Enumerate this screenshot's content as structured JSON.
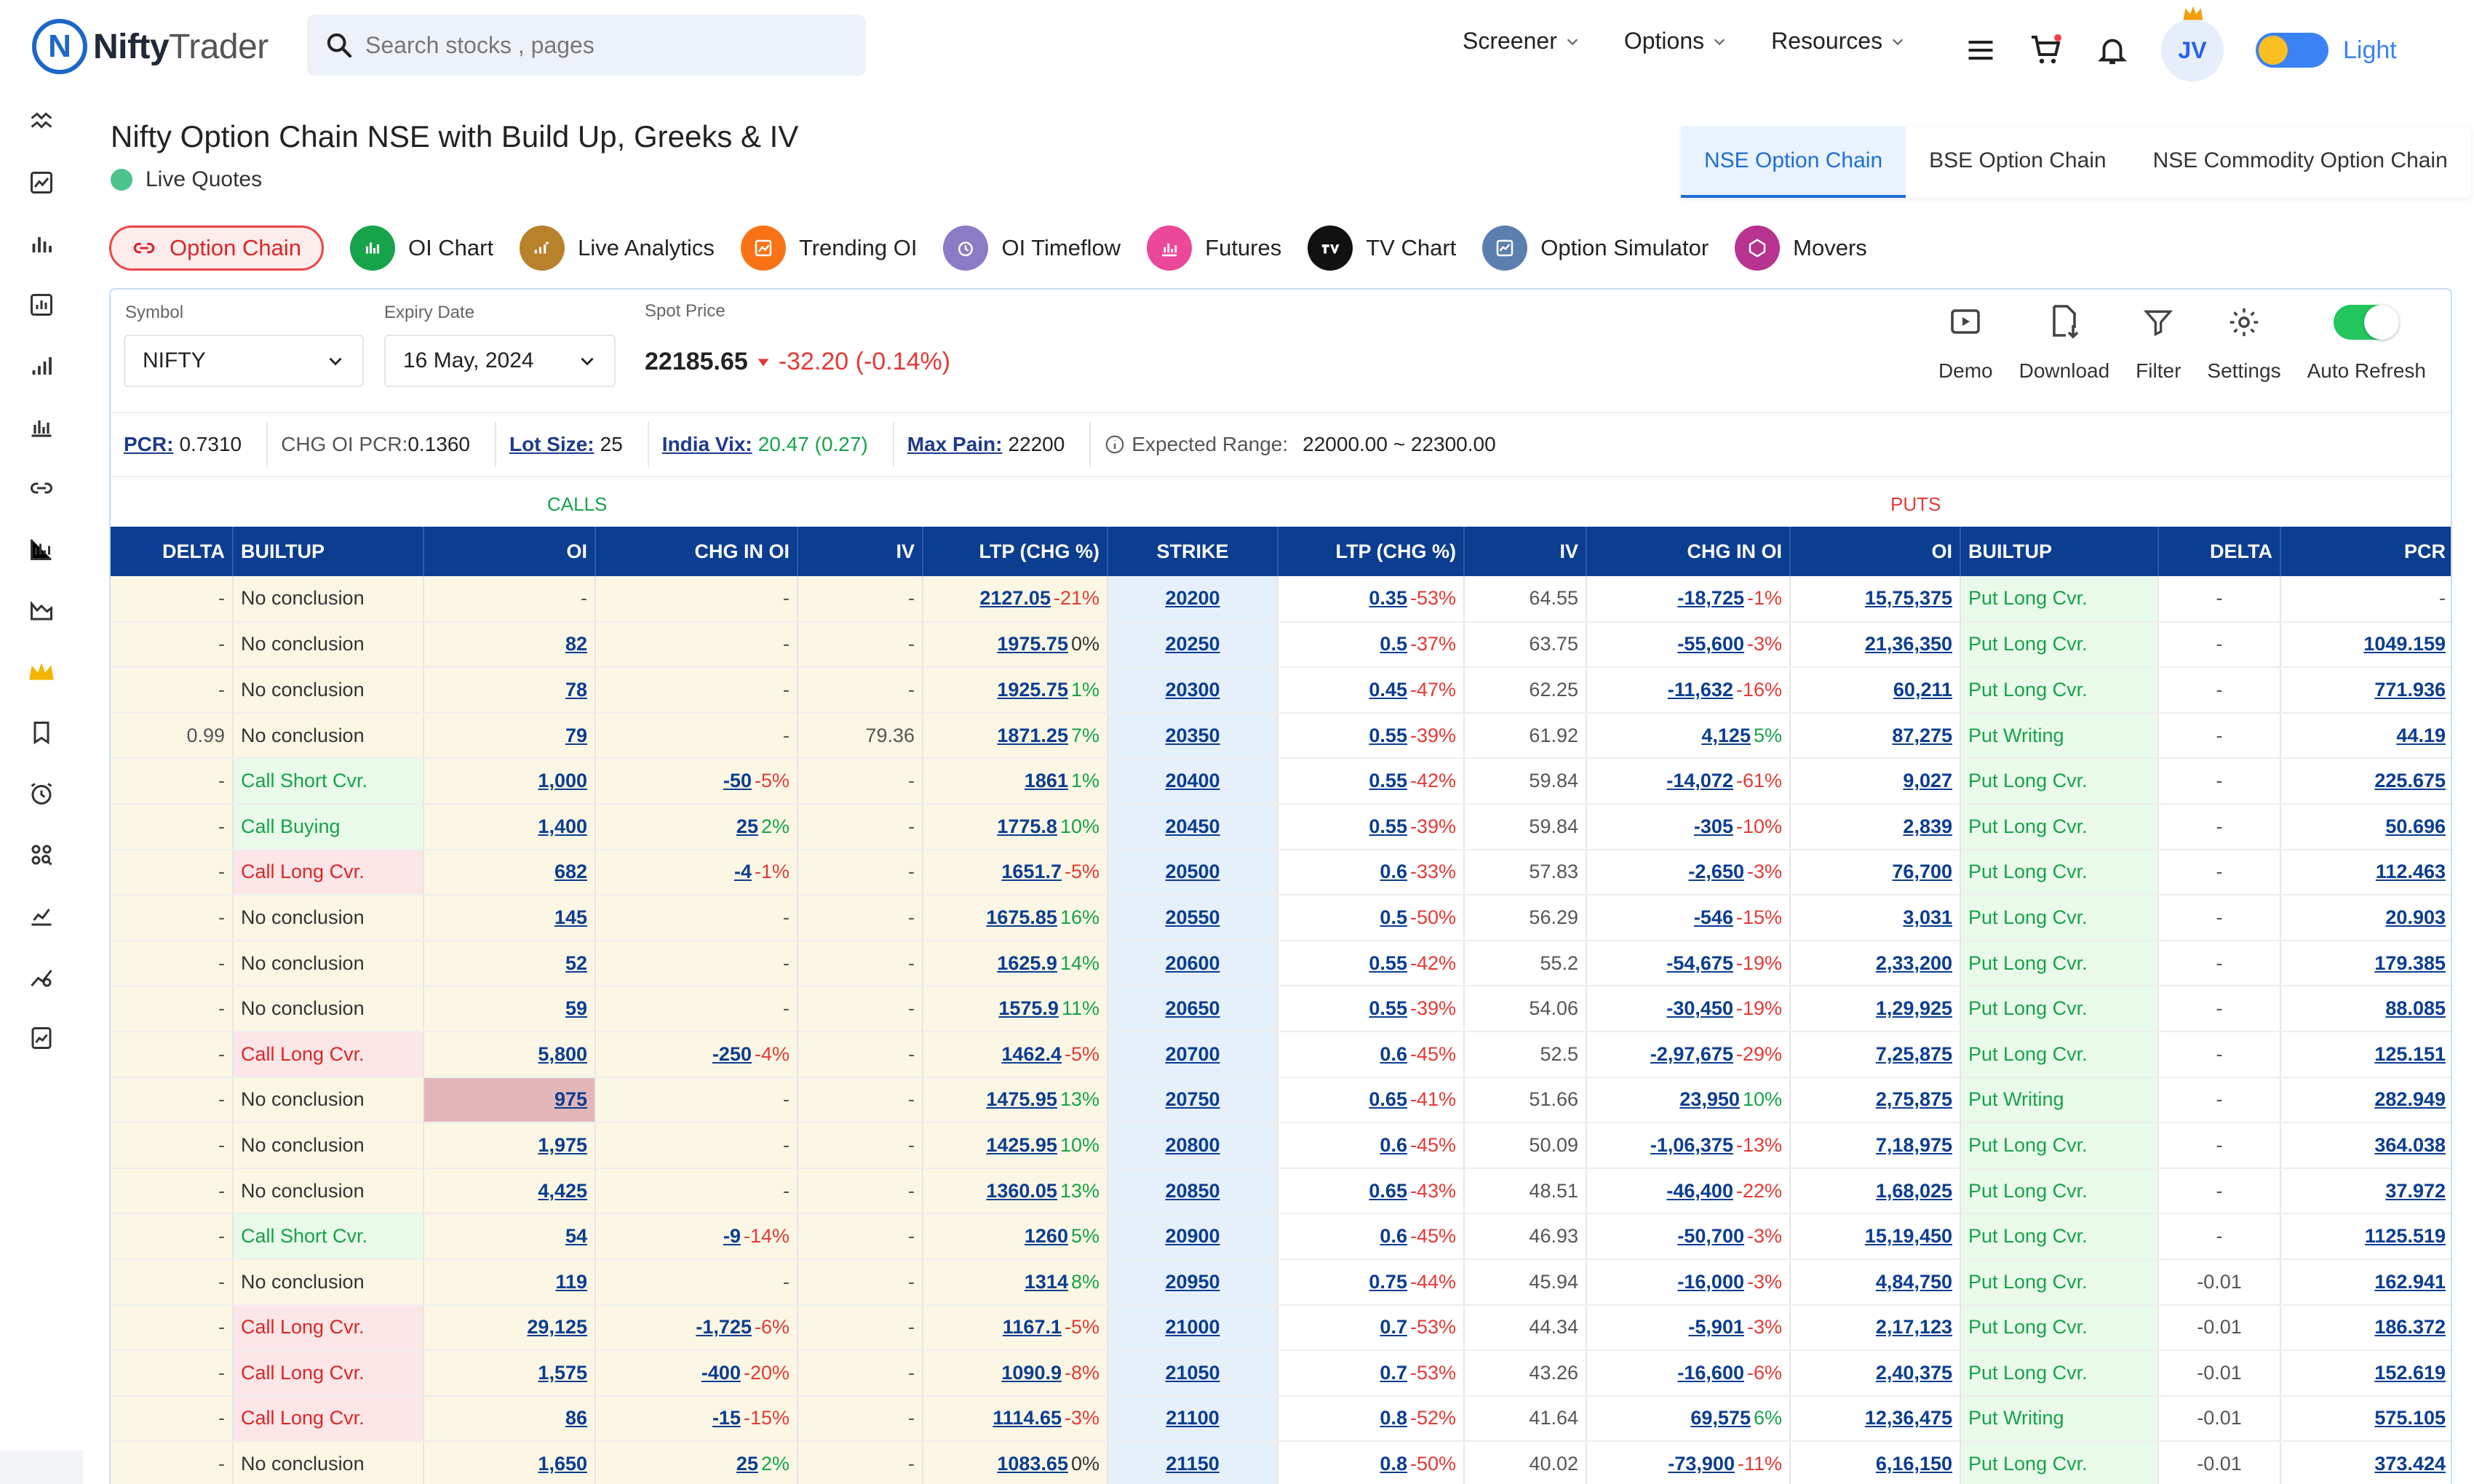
{
  "brand": {
    "name": "NiftyTrader",
    "name_a": "Nifty",
    "name_b": "Trader"
  },
  "search": {
    "placeholder": "Search stocks , pages"
  },
  "nav": {
    "screener": "Screener",
    "options": "Options",
    "resources": "Resources"
  },
  "user": {
    "initials": "JV"
  },
  "theme": {
    "label": "Light"
  },
  "page": {
    "title": "Nifty Option Chain NSE with Build Up, Greeks & IV",
    "live": "Live Quotes"
  },
  "chain_tabs": [
    "NSE Option Chain",
    "BSE Option Chain",
    "NSE Commodity Option Chain"
  ],
  "tools": [
    "Option Chain",
    "OI Chart",
    "Live Analytics",
    "Trending OI",
    "OI Timeflow",
    "Futures",
    "TV Chart",
    "Option Simulator",
    "Movers"
  ],
  "filters": {
    "symbol_label": "Symbol",
    "symbol": "NIFTY",
    "expiry_label": "Expiry Date",
    "expiry": "16 May, 2024",
    "spot_label": "Spot Price",
    "spot": "22185.65",
    "spot_change": "-32.20 (-0.14%)"
  },
  "actions": [
    "Demo",
    "Download",
    "Filter",
    "Settings",
    "Auto Refresh"
  ],
  "stats": {
    "pcr_k": "PCR:",
    "pcr": "0.7310",
    "chgoi_k": "CHG OI PCR:",
    "chgoi": "0.1360",
    "lot_k": "Lot Size:",
    "lot": "25",
    "vix_k": "India Vix:",
    "vix": "20.47 (0.27)",
    "maxpain_k": "Max Pain:",
    "maxpain": "22200",
    "range_k": "Expected Range:",
    "range": "22000.00 ~ 22300.00"
  },
  "sides": {
    "calls": "CALLS",
    "puts": "PUTS"
  },
  "headers": [
    "DELTA",
    "BUILTUP",
    "OI",
    "CHG IN OI",
    "IV",
    "LTP (CHG %)",
    "STRIKE",
    "LTP (CHG %)",
    "IV",
    "CHG IN OI",
    "OI",
    "BUILTUP",
    "DELTA",
    "PCR"
  ],
  "rows": [
    {
      "cd": "-",
      "cb": "No conclusion",
      "cbt": "none",
      "coi": "-",
      "cchg": "-",
      "cchgp": "",
      "civ": "-",
      "cltp": "2127.05",
      "cltpp": "-21%",
      "strike": "20200",
      "pltp": "0.35",
      "pltpp": "-53%",
      "piv": "64.55",
      "pchg": "-18,725",
      "pchgp": "-1%",
      "poi": "15,75,375",
      "pb": "Put Long Cvr.",
      "pd": "-",
      "pcr": "-"
    },
    {
      "cd": "-",
      "cb": "No conclusion",
      "cbt": "none",
      "coi": "82",
      "cchg": "-",
      "cchgp": "",
      "civ": "-",
      "cltp": "1975.75",
      "cltpp": "0%",
      "strike": "20250",
      "pltp": "0.5",
      "pltpp": "-37%",
      "piv": "63.75",
      "pchg": "-55,600",
      "pchgp": "-3%",
      "poi": "21,36,350",
      "pb": "Put Long Cvr.",
      "pd": "-",
      "pcr": "1049.159"
    },
    {
      "cd": "-",
      "cb": "No conclusion",
      "cbt": "none",
      "coi": "78",
      "cchg": "-",
      "cchgp": "",
      "civ": "-",
      "cltp": "1925.75",
      "cltpp": "1%",
      "strike": "20300",
      "pltp": "0.45",
      "pltpp": "-47%",
      "piv": "62.25",
      "pchg": "-11,632",
      "pchgp": "-16%",
      "poi": "60,211",
      "pb": "Put Long Cvr.",
      "pd": "-",
      "pcr": "771.936"
    },
    {
      "cd": "0.99",
      "cb": "No conclusion",
      "cbt": "none",
      "coi": "79",
      "cchg": "-",
      "cchgp": "",
      "civ": "79.36",
      "cltp": "1871.25",
      "cltpp": "7%",
      "strike": "20350",
      "pltp": "0.55",
      "pltpp": "-39%",
      "piv": "61.92",
      "pchg": "4,125",
      "pchgp": "5%",
      "poi": "87,275",
      "pb": "Put Writing",
      "pd": "-",
      "pcr": "44.19"
    },
    {
      "cd": "-",
      "cb": "Call Short Cvr.",
      "cbt": "green",
      "coi": "1,000",
      "cchg": "-50",
      "cchgp": "-5%",
      "civ": "-",
      "cltp": "1861",
      "cltpp": "1%",
      "strike": "20400",
      "pltp": "0.55",
      "pltpp": "-42%",
      "piv": "59.84",
      "pchg": "-14,072",
      "pchgp": "-61%",
      "poi": "9,027",
      "pb": "Put Long Cvr.",
      "pd": "-",
      "pcr": "225.675"
    },
    {
      "cd": "-",
      "cb": "Call Buying",
      "cbt": "green",
      "coi": "1,400",
      "cchg": "25",
      "cchgp": "2%",
      "civ": "-",
      "cltp": "1775.8",
      "cltpp": "10%",
      "strike": "20450",
      "pltp": "0.55",
      "pltpp": "-39%",
      "piv": "59.84",
      "pchg": "-305",
      "pchgp": "-10%",
      "poi": "2,839",
      "pb": "Put Long Cvr.",
      "pd": "-",
      "pcr": "50.696"
    },
    {
      "cd": "-",
      "cb": "Call Long Cvr.",
      "cbt": "red",
      "coi": "682",
      "cchg": "-4",
      "cchgp": "-1%",
      "civ": "-",
      "cltp": "1651.7",
      "cltpp": "-5%",
      "strike": "20500",
      "pltp": "0.6",
      "pltpp": "-33%",
      "piv": "57.83",
      "pchg": "-2,650",
      "pchgp": "-3%",
      "poi": "76,700",
      "pb": "Put Long Cvr.",
      "pd": "-",
      "pcr": "112.463"
    },
    {
      "cd": "-",
      "cb": "No conclusion",
      "cbt": "none",
      "coi": "145",
      "cchg": "-",
      "cchgp": "",
      "civ": "-",
      "cltp": "1675.85",
      "cltpp": "16%",
      "strike": "20550",
      "pltp": "0.5",
      "pltpp": "-50%",
      "piv": "56.29",
      "pchg": "-546",
      "pchgp": "-15%",
      "poi": "3,031",
      "pb": "Put Long Cvr.",
      "pd": "-",
      "pcr": "20.903"
    },
    {
      "cd": "-",
      "cb": "No conclusion",
      "cbt": "none",
      "coi": "52",
      "cchg": "-",
      "cchgp": "",
      "civ": "-",
      "cltp": "1625.9",
      "cltpp": "14%",
      "strike": "20600",
      "pltp": "0.55",
      "pltpp": "-42%",
      "piv": "55.2",
      "pchg": "-54,675",
      "pchgp": "-19%",
      "poi": "2,33,200",
      "pb": "Put Long Cvr.",
      "pd": "-",
      "pcr": "179.385"
    },
    {
      "cd": "-",
      "cb": "No conclusion",
      "cbt": "none",
      "coi": "59",
      "cchg": "-",
      "cchgp": "",
      "civ": "-",
      "cltp": "1575.9",
      "cltpp": "11%",
      "strike": "20650",
      "pltp": "0.55",
      "pltpp": "-39%",
      "piv": "54.06",
      "pchg": "-30,450",
      "pchgp": "-19%",
      "poi": "1,29,925",
      "pb": "Put Long Cvr.",
      "pd": "-",
      "pcr": "88.085"
    },
    {
      "cd": "-",
      "cb": "Call Long Cvr.",
      "cbt": "red",
      "coi": "5,800",
      "cchg": "-250",
      "cchgp": "-4%",
      "civ": "-",
      "cltp": "1462.4",
      "cltpp": "-5%",
      "strike": "20700",
      "pltp": "0.6",
      "pltpp": "-45%",
      "piv": "52.5",
      "pchg": "-2,97,675",
      "pchgp": "-29%",
      "poi": "7,25,875",
      "pb": "Put Long Cvr.",
      "pd": "-",
      "pcr": "125.151"
    },
    {
      "cd": "-",
      "cb": "No conclusion",
      "cbt": "none",
      "coi": "975",
      "cchg": "-",
      "cchgp": "",
      "civ": "-",
      "cltp": "1475.95",
      "cltpp": "13%",
      "strike": "20750",
      "pltp": "0.65",
      "pltpp": "-41%",
      "piv": "51.66",
      "pchg": "23,950",
      "pchgp": "10%",
      "poi": "2,75,875",
      "pb": "Put Writing",
      "pd": "-",
      "pcr": "282.949",
      "hl": true
    },
    {
      "cd": "-",
      "cb": "No conclusion",
      "cbt": "none",
      "coi": "1,975",
      "cchg": "-",
      "cchgp": "",
      "civ": "-",
      "cltp": "1425.95",
      "cltpp": "10%",
      "strike": "20800",
      "pltp": "0.6",
      "pltpp": "-45%",
      "piv": "50.09",
      "pchg": "-1,06,375",
      "pchgp": "-13%",
      "poi": "7,18,975",
      "pb": "Put Long Cvr.",
      "pd": "-",
      "pcr": "364.038"
    },
    {
      "cd": "-",
      "cb": "No conclusion",
      "cbt": "none",
      "coi": "4,425",
      "cchg": "-",
      "cchgp": "",
      "civ": "-",
      "cltp": "1360.05",
      "cltpp": "13%",
      "strike": "20850",
      "pltp": "0.65",
      "pltpp": "-43%",
      "piv": "48.51",
      "pchg": "-46,400",
      "pchgp": "-22%",
      "poi": "1,68,025",
      "pb": "Put Long Cvr.",
      "pd": "-",
      "pcr": "37.972"
    },
    {
      "cd": "-",
      "cb": "Call Short Cvr.",
      "cbt": "green",
      "coi": "54",
      "cchg": "-9",
      "cchgp": "-14%",
      "civ": "-",
      "cltp": "1260",
      "cltpp": "5%",
      "strike": "20900",
      "pltp": "0.6",
      "pltpp": "-45%",
      "piv": "46.93",
      "pchg": "-50,700",
      "pchgp": "-3%",
      "poi": "15,19,450",
      "pb": "Put Long Cvr.",
      "pd": "-",
      "pcr": "1125.519"
    },
    {
      "cd": "-",
      "cb": "No conclusion",
      "cbt": "none",
      "coi": "119",
      "cchg": "-",
      "cchgp": "",
      "civ": "-",
      "cltp": "1314",
      "cltpp": "8%",
      "strike": "20950",
      "pltp": "0.75",
      "pltpp": "-44%",
      "piv": "45.94",
      "pchg": "-16,000",
      "pchgp": "-3%",
      "poi": "4,84,750",
      "pb": "Put Long Cvr.",
      "pd": "-0.01",
      "pcr": "162.941"
    },
    {
      "cd": "-",
      "cb": "Call Long Cvr.",
      "cbt": "red",
      "coi": "29,125",
      "cchg": "-1,725",
      "cchgp": "-6%",
      "civ": "-",
      "cltp": "1167.1",
      "cltpp": "-5%",
      "strike": "21000",
      "pltp": "0.7",
      "pltpp": "-53%",
      "piv": "44.34",
      "pchg": "-5,901",
      "pchgp": "-3%",
      "poi": "2,17,123",
      "pb": "Put Long Cvr.",
      "pd": "-0.01",
      "pcr": "186.372"
    },
    {
      "cd": "-",
      "cb": "Call Long Cvr.",
      "cbt": "red",
      "coi": "1,575",
      "cchg": "-400",
      "cchgp": "-20%",
      "civ": "-",
      "cltp": "1090.9",
      "cltpp": "-8%",
      "strike": "21050",
      "pltp": "0.7",
      "pltpp": "-53%",
      "piv": "43.26",
      "pchg": "-16,600",
      "pchgp": "-6%",
      "poi": "2,40,375",
      "pb": "Put Long Cvr.",
      "pd": "-0.01",
      "pcr": "152.619"
    },
    {
      "cd": "-",
      "cb": "Call Long Cvr.",
      "cbt": "red",
      "coi": "86",
      "cchg": "-15",
      "cchgp": "-15%",
      "civ": "-",
      "cltp": "1114.65",
      "cltpp": "-3%",
      "strike": "21100",
      "pltp": "0.8",
      "pltpp": "-52%",
      "piv": "41.64",
      "pchg": "69,575",
      "pchgp": "6%",
      "poi": "12,36,475",
      "pb": "Put Writing",
      "pd": "-0.01",
      "pcr": "575.105"
    },
    {
      "cd": "-",
      "cb": "No conclusion",
      "cbt": "none",
      "coi": "1,650",
      "cchg": "25",
      "cchgp": "2%",
      "civ": "-",
      "cltp": "1083.65",
      "cltpp": "0%",
      "strike": "21150",
      "pltp": "0.8",
      "pltpp": "-50%",
      "piv": "40.02",
      "pchg": "-73,900",
      "pchgp": "-11%",
      "poi": "6,16,150",
      "pb": "Put Long Cvr.",
      "pd": "-0.01",
      "pcr": "373.424"
    }
  ]
}
